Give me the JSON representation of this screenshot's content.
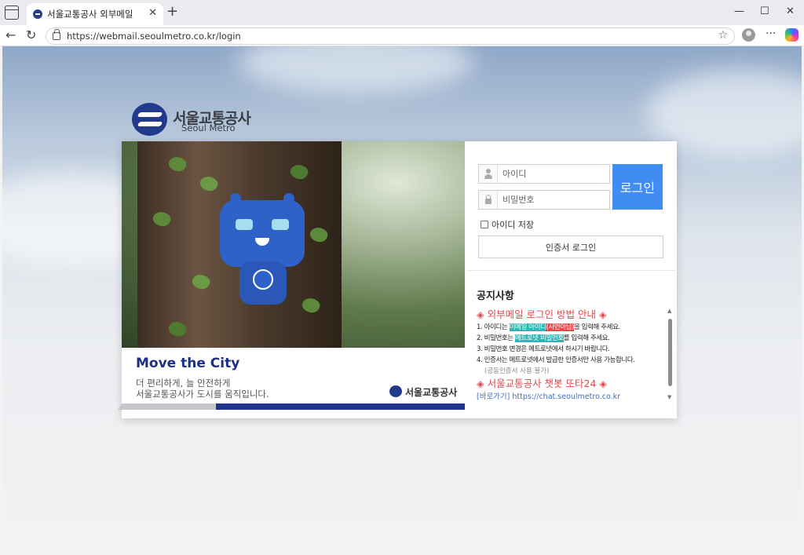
{
  "browser": {
    "tab_title": "서울교통공사 외부메일",
    "url": "https://webmail.seoulmetro.co.kr/login",
    "new_tab": "+",
    "window_controls": [
      "—",
      "☐",
      "✕"
    ],
    "icons": [
      "tab-actions-icon",
      "favicon-icon",
      "close-tab-icon",
      "back-icon",
      "refresh-icon",
      "lock-icon",
      "favorite-star-icon",
      "profile-icon",
      "more-menu-icon",
      "copilot-icon"
    ]
  },
  "logo": {
    "korean": "서울교통공사",
    "english": "Seoul Metro"
  },
  "visual": {
    "slogan": "Move the City",
    "sub_line1": "더 편리하게, 늘 안전하게",
    "sub_line2": "서울교통공사가 도시를 움직입니다.",
    "small_logo": "서울교통공사"
  },
  "login": {
    "id_placeholder": "아이디",
    "pw_placeholder": "비밀번호",
    "login_button": "로그인",
    "save_id_label": "아이디 저장",
    "cert_login_button": "인증서 로그인"
  },
  "notice": {
    "title": "공지사항",
    "heading1": "◈ 외부메일 로그인 방법 안내 ◈",
    "line1_a": "1. 아이디는 ",
    "line1_hl": "이메일 아이디",
    "line1_hl2": "(사번아님)",
    "line1_b": "을 입력해 주세요.",
    "line2_a": "2. 비밀번호는 ",
    "line2_hl": "메트로넷 비밀번호",
    "line2_b": "를 입력해 주세요.",
    "line3": "3. 비밀번호 변경은 메트로넷에서 하시기 바랍니다.",
    "line4": "4. 인증서는 메트로넷에서 발급한 인증서만 사용 가능합니다.",
    "line4_note": "(공동인증서 사용 불가)",
    "heading2": "◈ 서울교통공사 챗봇 또타24 ◈",
    "shortcut_label": "[바로가기]",
    "shortcut_url": "https://chat.seoulmetro.co.kr"
  },
  "colors": {
    "brand_navy": "#1f358e",
    "login_blue": "#3f8cf3",
    "notice_red": "#e24a4a",
    "highlight_teal": "#2fb5b5"
  }
}
